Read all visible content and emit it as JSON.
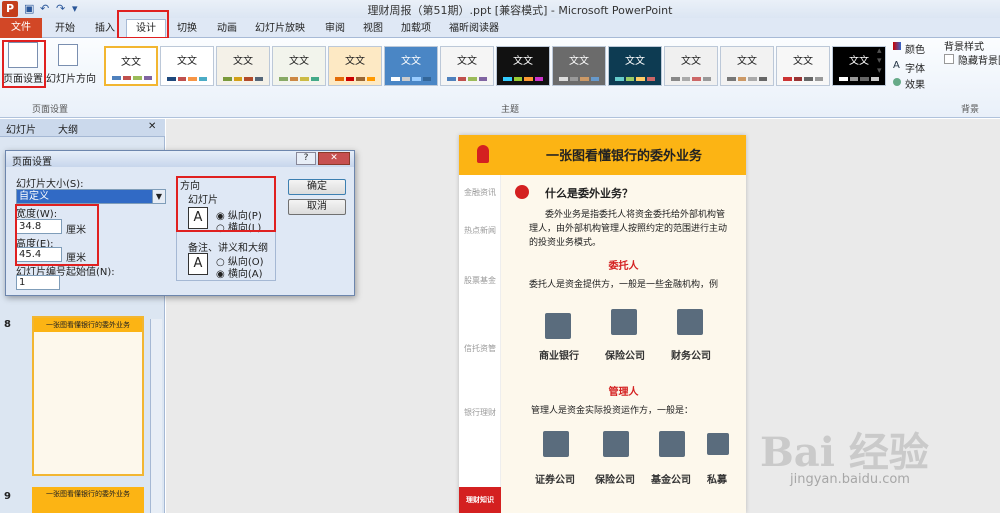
{
  "window": {
    "title": "理财周报（第51期）.ppt [兼容模式] - Microsoft PowerPoint",
    "logo": "P"
  },
  "tabs": [
    "文件",
    "开始",
    "插入",
    "设计",
    "切换",
    "动画",
    "幻灯片放映",
    "审阅",
    "视图",
    "加载项",
    "福昕阅读器"
  ],
  "ribbon": {
    "page_setup": "页面设置",
    "orientation": "幻灯片方向",
    "group_page": "页面设置",
    "group_theme": "主题",
    "group_bg": "背景",
    "theme_label": "文文",
    "colors": "颜色",
    "fonts": "字体",
    "effects": "效果",
    "bg_style": "背景样式",
    "hide_bg": "隐藏背景图形"
  },
  "panel": {
    "tab_slides": "幻灯片",
    "tab_outline": "大纲",
    "close": "✕",
    "slide8": "8",
    "slide9": "9",
    "thumb_title": "一张图看懂银行的委外业务"
  },
  "dialog": {
    "title": "页面设置",
    "help": "?",
    "close": "✕",
    "size_label": "幻灯片大小(S):",
    "size_value": "自定义",
    "width_label": "宽度(W):",
    "width_value": "34.8",
    "height_label": "高度(E):",
    "height_value": "45.4",
    "unit": "厘米",
    "number_label": "幻灯片编号起始值(N):",
    "number_value": "1",
    "orientation": "方向",
    "slides": "幻灯片",
    "portrait": "纵向(P)",
    "landscape": "横向(L)",
    "notes": "备注、讲义和大纲",
    "notes_portrait": "纵向(O)",
    "notes_landscape": "横向(A)",
    "ok": "确定",
    "cancel": "取消"
  },
  "slide": {
    "title": "一张图看懂银行的委外业务",
    "side": [
      "金融资讯",
      "热点新闻",
      "股票基金",
      "信托资管",
      "银行理财",
      "理财知识"
    ],
    "q": "什么是委外业务？",
    "intro1": "委外业务是指委托人将资金委托给外部机构管",
    "intro2": "理人，由外部机构管理人按照约定的范围进行主动",
    "intro3": "的投资业务模式。",
    "h1": "委托人",
    "p1": "委托人是资金提供方，一般是一些金融机构，例",
    "icons1": [
      "商业银行",
      "保险公司",
      "财务公司"
    ],
    "h2": "管理人",
    "p2": "管理人是资金实际投资运作方，一般是：",
    "icons2": [
      "证券公司",
      "保险公司",
      "基金公司",
      "私募"
    ]
  },
  "watermark": "Bai 经验",
  "watermark_url": "jingyan.baidu.com",
  "colors": {
    "accent": "#fcb414",
    "red": "#e02020",
    "file_tab": "#d24726"
  }
}
